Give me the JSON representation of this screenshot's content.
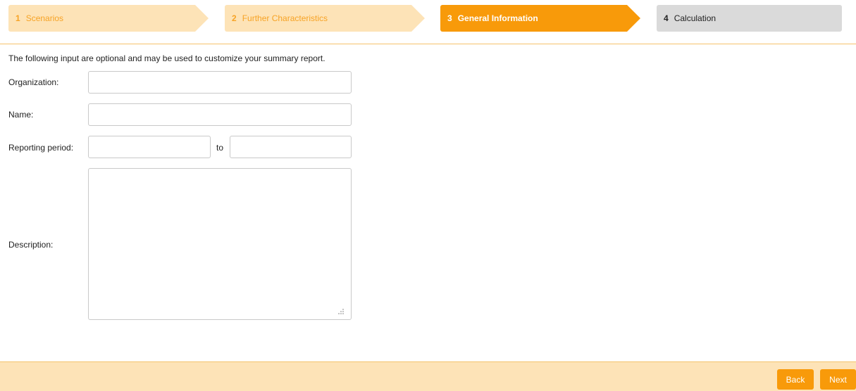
{
  "wizard": {
    "steps": [
      {
        "number": "1",
        "label": "Scenarios",
        "state": "done"
      },
      {
        "number": "2",
        "label": "Further Characteristics",
        "state": "done"
      },
      {
        "number": "3",
        "label": "General Information",
        "state": "active"
      },
      {
        "number": "4",
        "label": "Calculation",
        "state": "pending"
      }
    ]
  },
  "form": {
    "intro": "The following input are optional and may be used to customize your summary report.",
    "organization": {
      "label": "Organization:",
      "value": ""
    },
    "name": {
      "label": "Name:",
      "value": ""
    },
    "reporting_period": {
      "label": "Reporting period:",
      "from_value": "",
      "to_label": "to",
      "to_value": ""
    },
    "description": {
      "label": "Description:",
      "value": ""
    }
  },
  "footer": {
    "back_label": "Back",
    "next_label": "Next"
  },
  "colors": {
    "accent": "#f89a0a",
    "accent_light": "#fde3b7",
    "accent_text": "#f7a325",
    "pending": "#dadada",
    "divider": "#f5c36b"
  }
}
